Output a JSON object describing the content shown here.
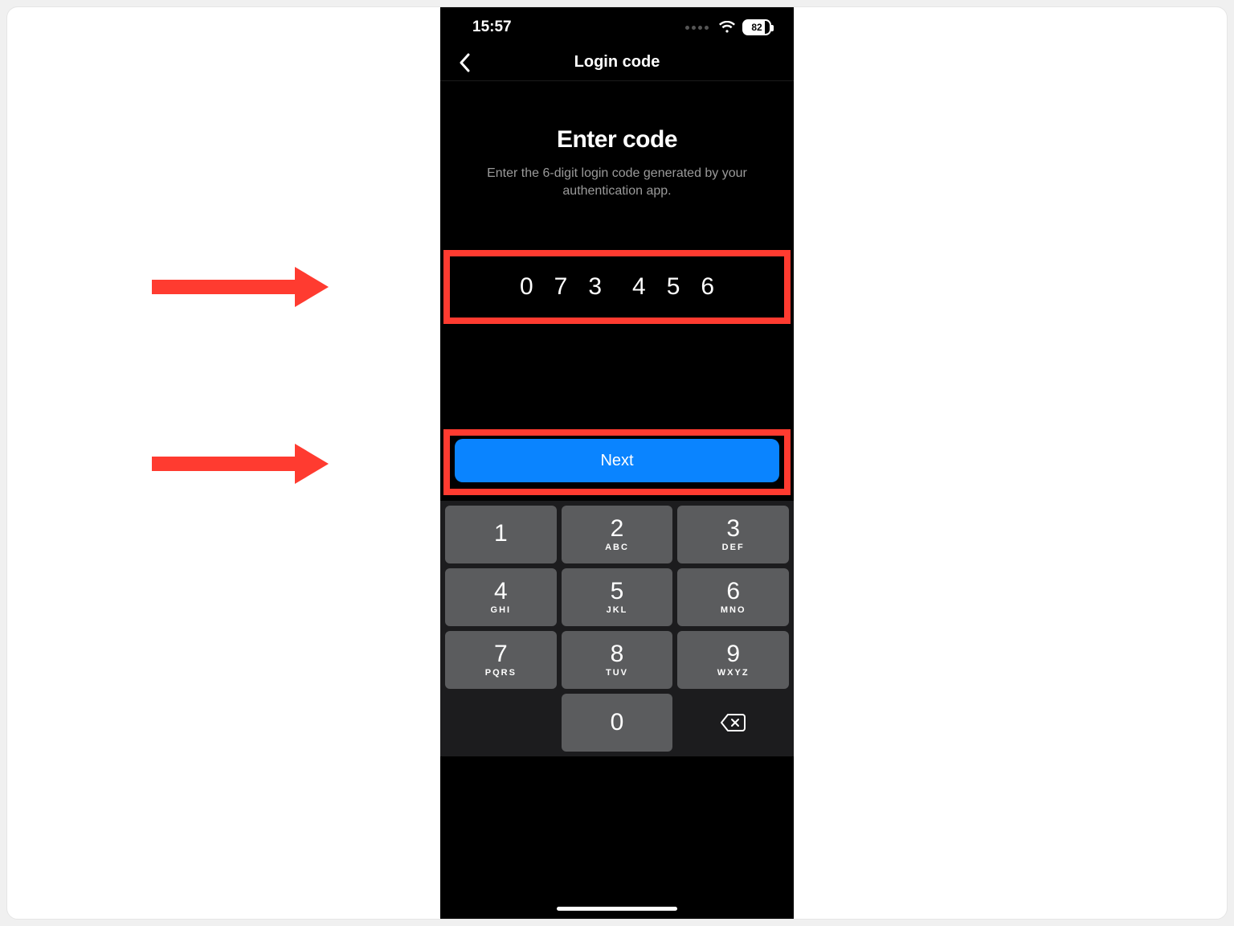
{
  "status": {
    "time": "15:57",
    "battery": "82"
  },
  "nav": {
    "title": "Login code"
  },
  "page": {
    "heading": "Enter code",
    "subheading": "Enter the 6-digit login code generated by your authentication app."
  },
  "code": {
    "digits": [
      "0",
      "7",
      "3",
      "4",
      "5",
      "6"
    ]
  },
  "actions": {
    "next": "Next"
  },
  "keypad": {
    "rows": [
      [
        {
          "num": "1",
          "letters": ""
        },
        {
          "num": "2",
          "letters": "ABC"
        },
        {
          "num": "3",
          "letters": "DEF"
        }
      ],
      [
        {
          "num": "4",
          "letters": "GHI"
        },
        {
          "num": "5",
          "letters": "JKL"
        },
        {
          "num": "6",
          "letters": "MNO"
        }
      ],
      [
        {
          "num": "7",
          "letters": "PQRS"
        },
        {
          "num": "8",
          "letters": "TUV"
        },
        {
          "num": "9",
          "letters": "WXYZ"
        }
      ]
    ],
    "zero": {
      "num": "0",
      "letters": ""
    }
  }
}
